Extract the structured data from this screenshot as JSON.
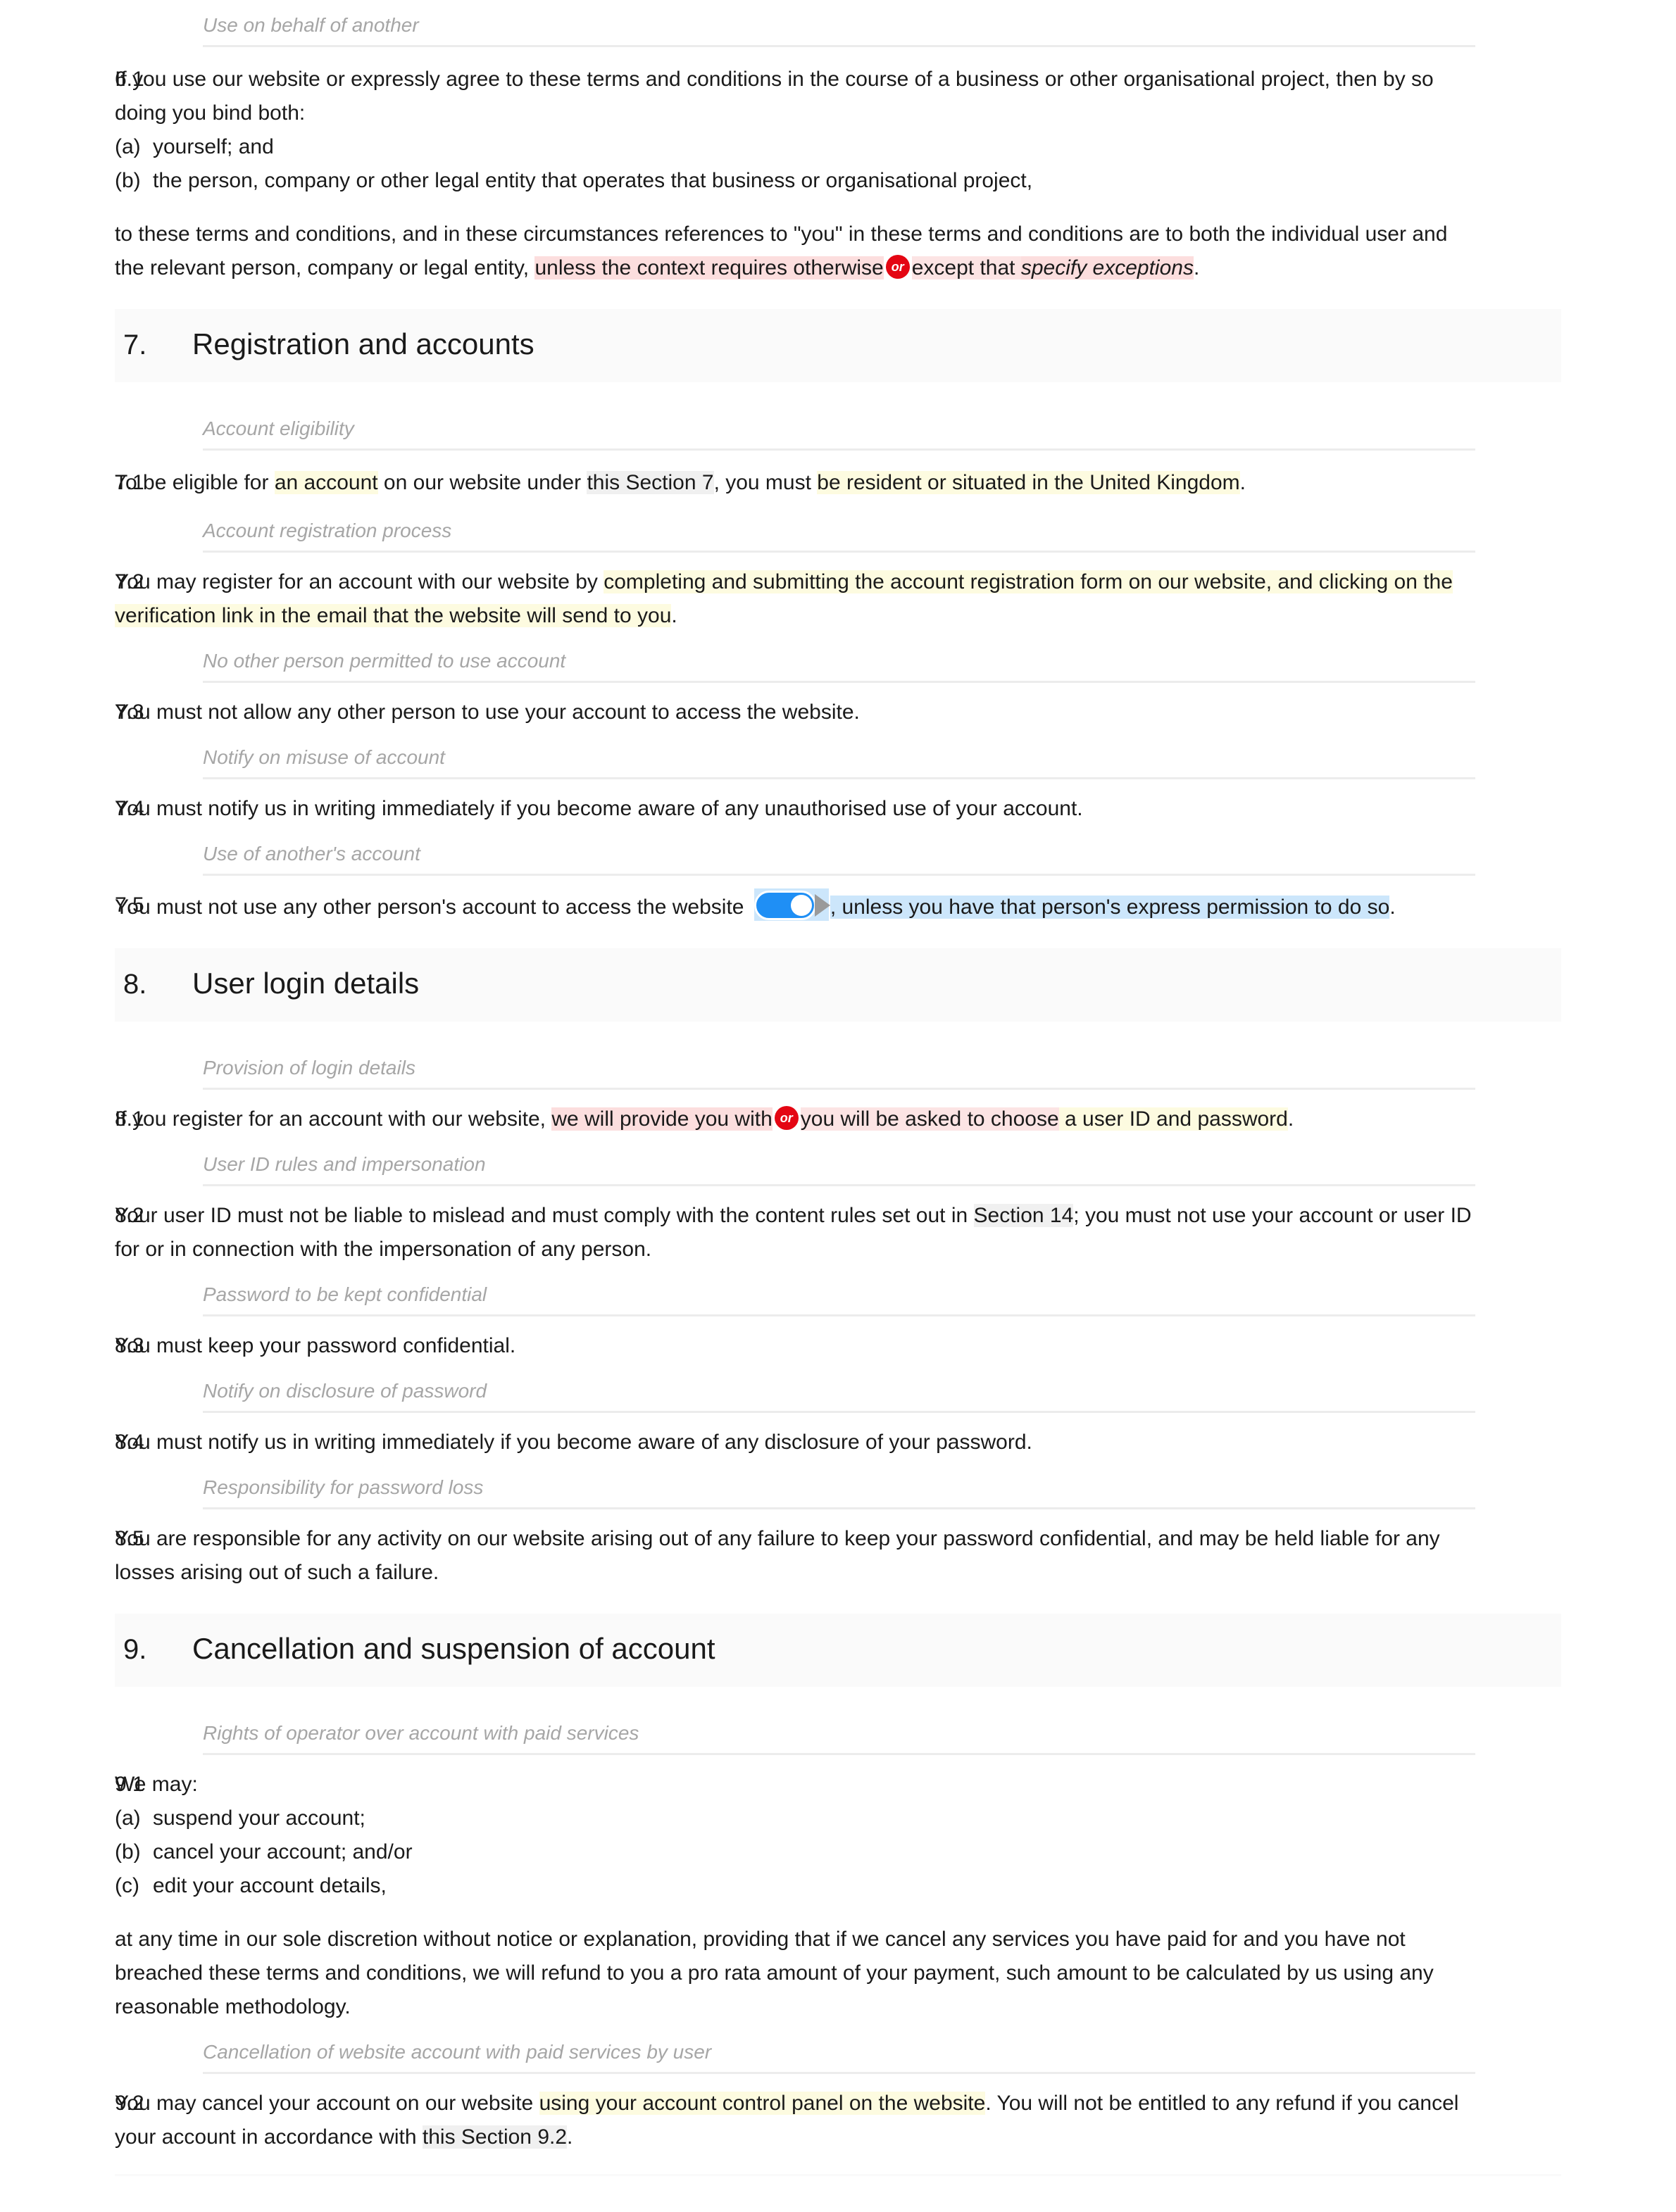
{
  "document": {
    "type": "terms-and-conditions",
    "colors": {
      "highlight_yellow": "#fdfbe0",
      "highlight_pink": "#fcdede",
      "highlight_grey": "#f0f0f0",
      "highlight_blue": "#cce6fb",
      "or_badge_red": "#e40613",
      "toggle_blue": "#1f8ff5",
      "subheading_grey": "#a6a6a6",
      "section_band_grey": "#fafafa"
    }
  },
  "blocks": {
    "sub_use_on_behalf": "Use on behalf of another",
    "c6_1": {
      "num": "6.1",
      "lead": "If you use our website or expressly agree to these terms and conditions in the course of a business or other organisational project, then by so doing you bind both:",
      "item_a": "(a)",
      "item_a_text": "yourself; and",
      "item_b": "(b)",
      "item_b_text": "the person, company or other legal entity that operates that business or organisational project,",
      "tail_1": "to these terms and conditions, and in these circumstances references to \"you\" in these terms and conditions are to both the individual user and the relevant person, company or legal entity,",
      "option_1": "unless the context requires otherwise",
      "or_badge": "or",
      "option_2_pre": "except that",
      "option_2_italic": "specify exceptions",
      "tail_2": "."
    },
    "section_7": {
      "num": "7.",
      "title": "Registration and accounts"
    },
    "sub_account_eligibility": "Account eligibility",
    "c7_1": {
      "num": "7.1",
      "p1": "To be eligible for ",
      "hl1": "an account",
      "p2": " on our website under ",
      "hl2": "this Section 7",
      "p3": ", you must ",
      "hl3": "be resident or situated in the United Kingdom",
      "p4": "."
    },
    "sub_registration_process": "Account registration process",
    "c7_2": {
      "num": "7.2",
      "p1": "You may register for an account with our website by ",
      "hl1": "completing and submitting the account registration form on our website, and clicking on the verification link in the email that the website will send to you",
      "p2": "."
    },
    "sub_no_other_person": "No other person permitted to use account",
    "c7_3": {
      "num": "7.3",
      "text": "You must not allow any other person to use your account to access the website."
    },
    "sub_notify_misuse": "Notify on misuse of account",
    "c7_4": {
      "num": "7.4",
      "text": "You must notify us in writing immediately if you become aware of any unauthorised use of your account."
    },
    "sub_use_another_account": "Use of another's account",
    "c7_5": {
      "num": "7.5",
      "p1": "You must not use any other person's account to access the website ",
      "toggle_state": "on",
      "hl1": ", unless you have that person's express permission to do so",
      "p2": "."
    },
    "section_8": {
      "num": "8.",
      "title": "User login details"
    },
    "sub_provision_login": "Provision of login details",
    "c8_1": {
      "num": "8.1",
      "p1": "If you register for an account with our website, ",
      "option_1": "we will provide you with",
      "or_badge": "or",
      "option_2": "you will be asked to choose",
      "hl_yellow": " a user ID and password",
      "p2": "."
    },
    "sub_userid_rules": "User ID rules and impersonation",
    "c8_2": {
      "num": "8.2",
      "p1": "Your user ID must not be liable to mislead and must comply with the content rules set out in ",
      "hl1": "Section 14",
      "p2": "; you must not use your account or user ID for or in connection with the impersonation of any person."
    },
    "sub_password_confidential": "Password to be kept confidential",
    "c8_3": {
      "num": "8.3",
      "text": "You must keep your password confidential."
    },
    "sub_notify_disclosure": "Notify on disclosure of password",
    "c8_4": {
      "num": "8.4",
      "text": "You must notify us in writing immediately if you become aware of any disclosure of your password."
    },
    "sub_responsibility_loss": "Responsibility for password loss",
    "c8_5": {
      "num": "8.5",
      "text": "You are responsible for any activity on our website arising out of any failure to keep your password confidential, and may be held liable for any losses arising out of such a failure."
    },
    "section_9": {
      "num": "9.",
      "title": "Cancellation and suspension of account"
    },
    "sub_rights_operator": "Rights of operator over account with paid services",
    "c9_1": {
      "num": "9.1",
      "lead": "We may:",
      "item_a": "(a)",
      "item_a_text": "suspend your account;",
      "item_b": "(b)",
      "item_b_text": "cancel your account; and/or",
      "item_c": "(c)",
      "item_c_text": "edit your account details,",
      "tail": "at any time in our sole discretion without notice or explanation, providing that if we cancel any services you have paid for and you have not breached these terms and conditions, we will refund to you a pro rata amount of your payment, such amount to be calculated by us using any reasonable methodology."
    },
    "sub_cancellation_user": "Cancellation of website account with paid services by user",
    "c9_2": {
      "num": "9.2",
      "p1": "You may cancel your account on our website ",
      "hl1": "using your account control panel on the website",
      "p2": ". You will not be entitled to any refund if you cancel your account in accordance with ",
      "hl2": "this Section 9.2",
      "p3": "."
    }
  }
}
